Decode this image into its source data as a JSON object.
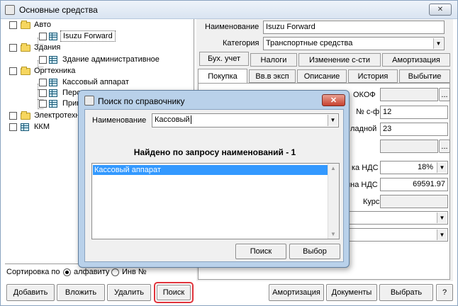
{
  "window": {
    "title": "Основные средства",
    "close": "✕"
  },
  "tree": [
    {
      "label": "Авто",
      "type": "folder"
    },
    {
      "label": "Isuzu Forward",
      "type": "item",
      "selected": true
    },
    {
      "label": "Здания",
      "type": "folder"
    },
    {
      "label": "Здание административное",
      "type": "item"
    },
    {
      "label": "Оргтехника",
      "type": "folder"
    },
    {
      "label": "Кассовый аппарат",
      "type": "item"
    },
    {
      "label": "Перс",
      "type": "item"
    },
    {
      "label": "Прин",
      "type": "item"
    },
    {
      "label": "Электротехн",
      "type": "folder"
    },
    {
      "label": "ККМ",
      "type": "item"
    }
  ],
  "sort": {
    "label": "Сортировка по",
    "option1": "алфавиту",
    "option2": "Инв №"
  },
  "bottom_buttons": {
    "add": "Добавить",
    "insert": "Вложить",
    "delete": "Удалить",
    "search": "Поиск",
    "amort": "Амортизация",
    "docs": "Документы",
    "choose": "Выбрать",
    "help": "?"
  },
  "form": {
    "name_label": "Наименование",
    "name_value": "Isuzu Forward",
    "category_label": "Категория",
    "category_value": "Транспортные средства"
  },
  "tabs_row1": [
    "Бух. учет",
    "Налоги",
    "Изменение с-сти",
    "Амортизация"
  ],
  "tabs_row2": [
    "Покупка",
    "Вв.в эксп",
    "Описание",
    "История",
    "Выбытие"
  ],
  "right_fields": {
    "okof_label": "ОКОФ",
    "sf_label": "№ с-ф",
    "sf_value": "12",
    "nakl_label": "ладной",
    "nakl_value": "23",
    "nds_rate_label": "ка НДС",
    "nds_rate_value": "18%",
    "nds_sum_label": "ина НДС",
    "nds_sum_value": "69591.97",
    "rate_label": "Курс",
    "ellipsis": "..."
  },
  "dialog": {
    "title": "Поиск по справочнику",
    "name_label": "Наименование",
    "name_value": "Кассовый",
    "result_text": "Найдено по запросу наименований - 1",
    "results": [
      "Кассовый аппарат"
    ],
    "search_btn": "Поиск",
    "choose_btn": "Выбор",
    "close": "✕"
  },
  "colors": {
    "highlight": "#e0343c",
    "selection": "#3399ff",
    "dialog_frame": "#b9d1ea"
  }
}
